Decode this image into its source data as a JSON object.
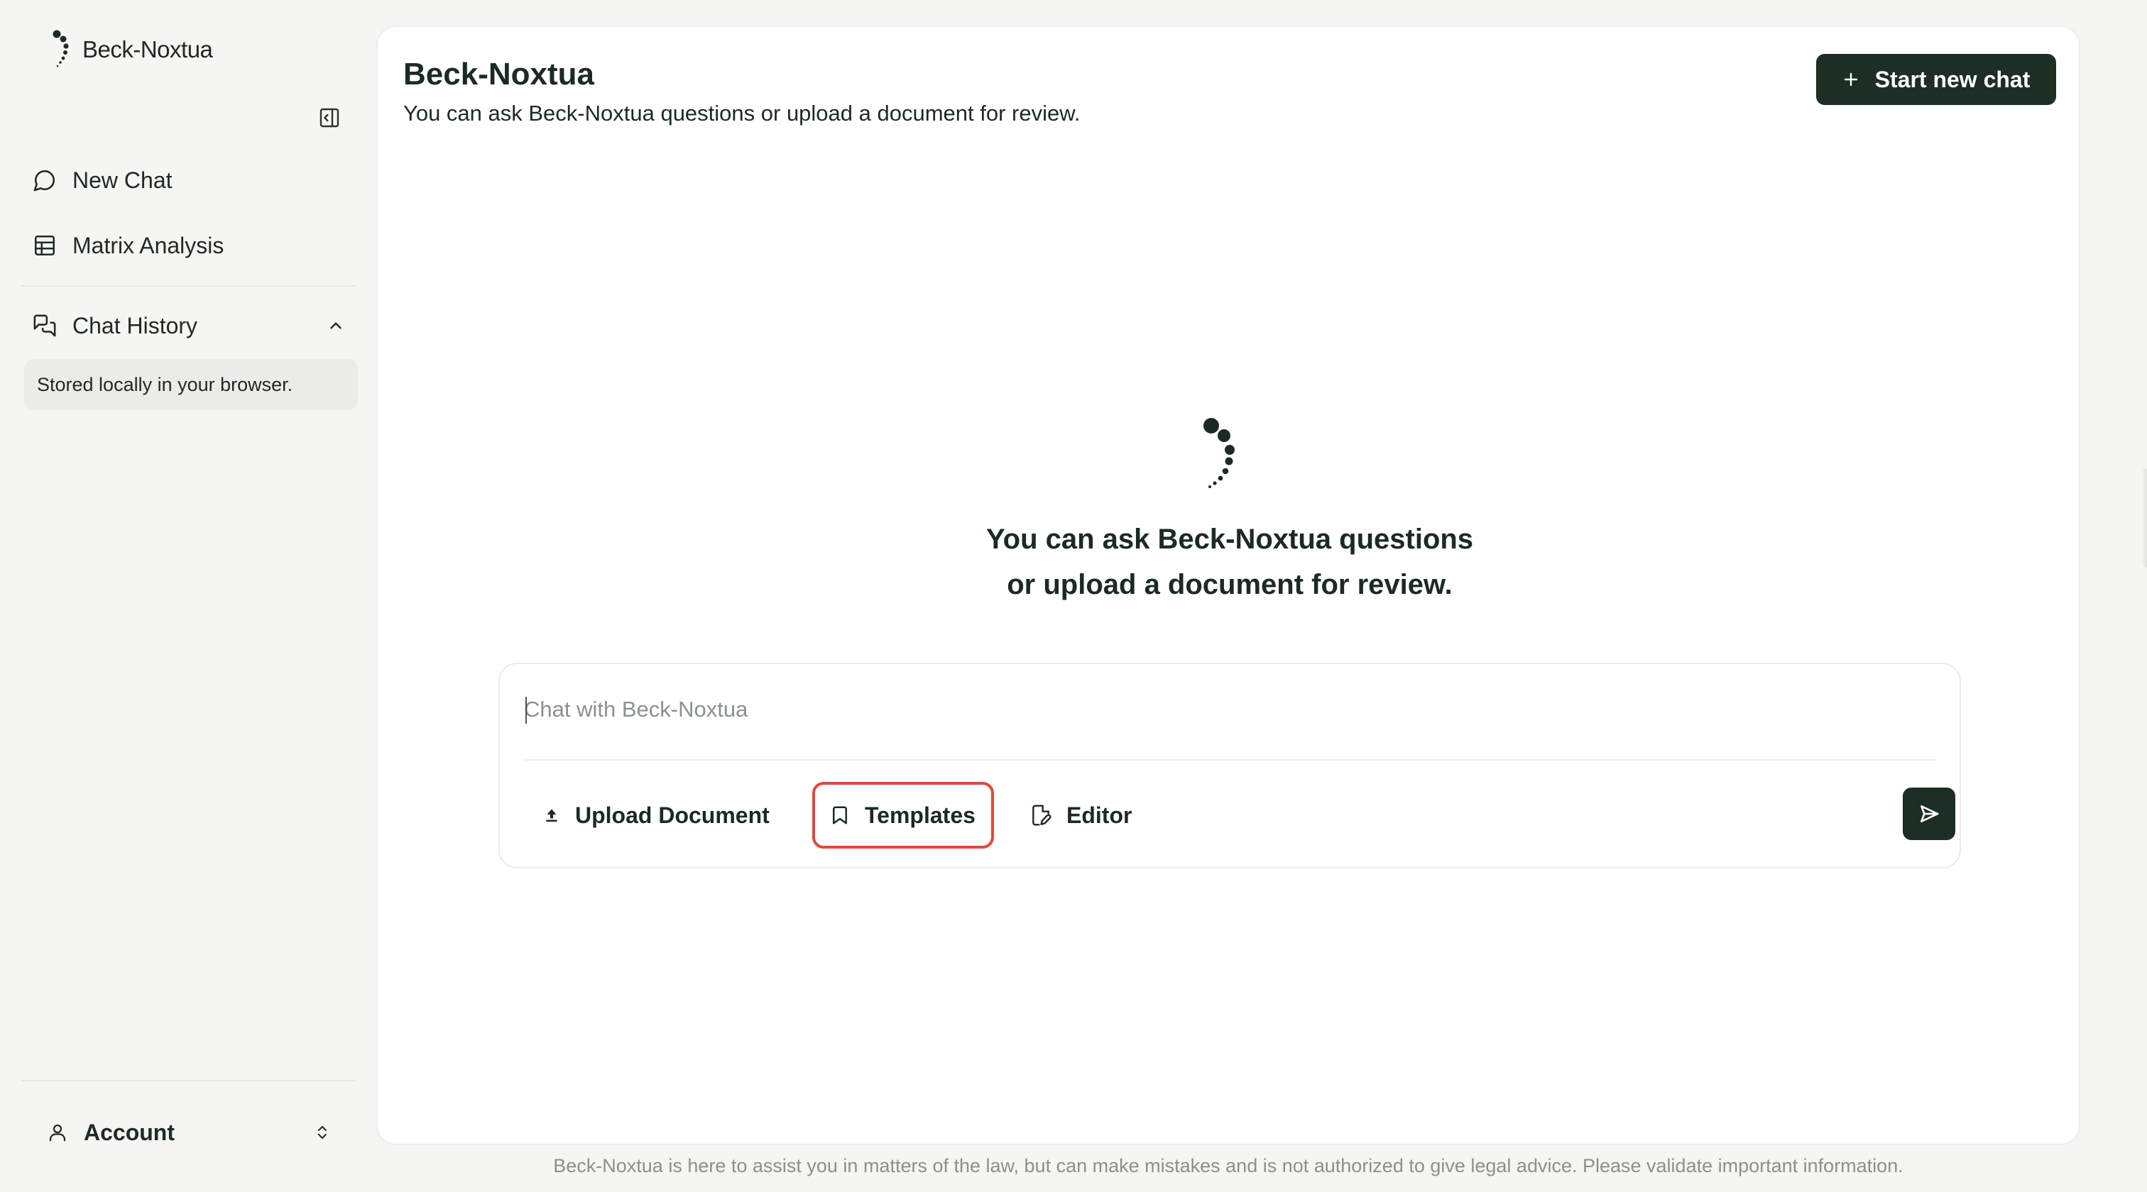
{
  "sidebar": {
    "brand": "Beck-Noxtua",
    "nav": {
      "new_chat": "New Chat",
      "matrix_analysis": "Matrix Analysis"
    },
    "history": {
      "title": "Chat History",
      "note": "Stored locally in your browser."
    },
    "account": "Account"
  },
  "main": {
    "title": "Beck-Noxtua",
    "subtitle": "You can ask Beck-Noxtua questions or upload a document for review.",
    "start_new_chat": "Start new chat",
    "hero_line1": "You can ask Beck-Noxtua questions",
    "hero_line2": "or upload a document for review.",
    "chat": {
      "placeholder": "Chat with Beck-Noxtua",
      "upload_label": "Upload Document",
      "templates_label": "Templates",
      "editor_label": "Editor"
    },
    "footer": "Beck-Noxtua is here to assist you in matters of the law, but can make mistakes and is not authorized to give legal advice. Please validate important information."
  },
  "colors": {
    "primary_dark": "#1d2e24",
    "highlight": "#e2483a",
    "background": "#f5f5f4"
  },
  "icons": {
    "logo": "dots-arc-icon",
    "collapse": "sidebar-collapse-icon",
    "new_chat": "chat-bubble-icon",
    "matrix": "table-grid-icon",
    "history": "chat-history-icon",
    "account": "user-icon",
    "upload": "upload-arrow-icon",
    "templates": "bookmark-icon",
    "editor": "file-edit-icon",
    "send": "send-icon"
  }
}
